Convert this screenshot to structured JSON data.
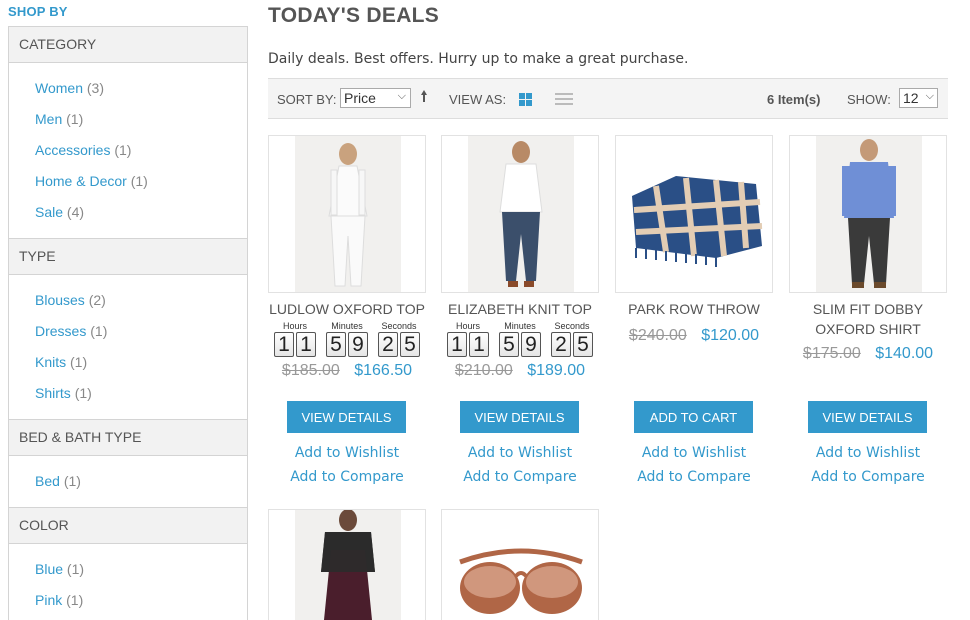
{
  "sidebar": {
    "heading": "SHOP BY",
    "filters": [
      {
        "title": "CATEGORY",
        "options": [
          {
            "label": "Women",
            "count": "(3)"
          },
          {
            "label": "Men",
            "count": "(1)"
          },
          {
            "label": "Accessories",
            "count": "(1)"
          },
          {
            "label": "Home & Decor",
            "count": "(1)"
          },
          {
            "label": "Sale",
            "count": "(4)"
          }
        ]
      },
      {
        "title": "TYPE",
        "options": [
          {
            "label": "Blouses",
            "count": "(2)"
          },
          {
            "label": "Dresses",
            "count": "(1)"
          },
          {
            "label": "Knits",
            "count": "(1)"
          },
          {
            "label": "Shirts",
            "count": "(1)"
          }
        ]
      },
      {
        "title": "BED & BATH TYPE",
        "options": [
          {
            "label": "Bed",
            "count": "(1)"
          }
        ]
      },
      {
        "title": "COLOR",
        "options": [
          {
            "label": "Blue",
            "count": "(1)"
          },
          {
            "label": "Pink",
            "count": "(1)"
          }
        ]
      }
    ]
  },
  "page": {
    "title": "TODAY'S DEALS",
    "description": "Daily deals. Best offers. Hurry up to make a great purchase."
  },
  "toolbar": {
    "sort_label": "SORT BY:",
    "sort_value": "Price",
    "view_label": "VIEW AS:",
    "items_count": "6 Item(s)",
    "show_label": "SHOW:",
    "show_value": "12"
  },
  "timer_labels": {
    "hours": "Hours",
    "minutes": "Minutes",
    "seconds": "Seconds"
  },
  "products": [
    {
      "name": "LUDLOW OXFORD TOP",
      "timer": [
        "1",
        "1",
        "5",
        "9",
        "2",
        "5"
      ],
      "old_price": "$185.00",
      "new_price": "$166.50",
      "button": "VIEW DETAILS",
      "wishlist": "Add to Wishlist",
      "compare": "Add to Compare"
    },
    {
      "name": "ELIZABETH KNIT TOP",
      "timer": [
        "1",
        "1",
        "5",
        "9",
        "2",
        "5"
      ],
      "old_price": "$210.00",
      "new_price": "$189.00",
      "button": "VIEW DETAILS",
      "wishlist": "Add to Wishlist",
      "compare": "Add to Compare"
    },
    {
      "name": "PARK ROW THROW",
      "old_price": "$240.00",
      "new_price": "$120.00",
      "button": "ADD TO CART",
      "wishlist": "Add to Wishlist",
      "compare": "Add to Compare"
    },
    {
      "name": "SLIM FIT DOBBY OXFORD SHIRT",
      "old_price": "$175.00",
      "new_price": "$140.00",
      "button": "VIEW DETAILS",
      "wishlist": "Add to Wishlist",
      "compare": "Add to Compare"
    }
  ],
  "icons": {
    "sort_direction": "sort-up-arrow-icon",
    "grid_view": "grid-view-icon",
    "list_view": "list-view-icon"
  },
  "colors": {
    "accent": "#3399cc",
    "old_price": "#999999"
  }
}
